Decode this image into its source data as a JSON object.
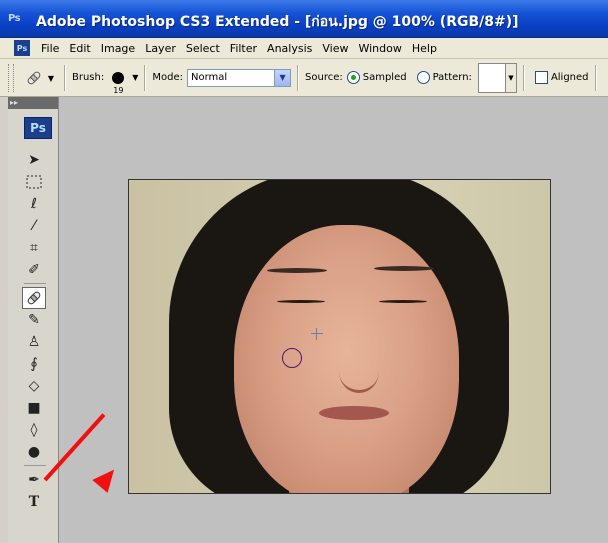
{
  "window": {
    "ps_badge": "Ps",
    "title": "Adobe Photoshop CS3 Extended - [ก่อน.jpg @ 100% (RGB/8#)]"
  },
  "menu": {
    "logo": "Ps",
    "items": [
      "File",
      "Edit",
      "Image",
      "Layer",
      "Select",
      "Filter",
      "Analysis",
      "View",
      "Window",
      "Help"
    ]
  },
  "options": {
    "tool_icon": "healing-brush-icon",
    "brush_label": "Brush:",
    "brush_size": "19",
    "mode_label": "Mode:",
    "mode_value": "Normal",
    "source_label": "Source:",
    "sampled_label": "Sampled",
    "pattern_label": "Pattern:",
    "aligned_label": "Aligned"
  },
  "toolbox": {
    "logo": "Ps",
    "tools": [
      {
        "name": "move-tool",
        "glyph": "▸✢"
      },
      {
        "name": "marquee-tool",
        "glyph": "⬚"
      },
      {
        "name": "lasso-tool",
        "glyph": "ℓ"
      },
      {
        "name": "magic-wand-tool",
        "glyph": "⁄"
      },
      {
        "name": "crop-tool",
        "glyph": "⌗"
      },
      {
        "name": "slice-tool",
        "glyph": "⁄"
      },
      {
        "name": "healing-brush-tool",
        "glyph": "✎",
        "active": true
      },
      {
        "name": "brush-tool",
        "glyph": "∕"
      },
      {
        "name": "clone-stamp-tool",
        "glyph": "♙"
      },
      {
        "name": "history-brush-tool",
        "glyph": "∮"
      },
      {
        "name": "eraser-tool",
        "glyph": "◊"
      },
      {
        "name": "gradient-tool",
        "glyph": "■"
      },
      {
        "name": "blur-tool",
        "glyph": "◮"
      },
      {
        "name": "dodge-tool",
        "glyph": "●"
      },
      {
        "name": "pen-tool",
        "glyph": "✒"
      },
      {
        "name": "type-tool",
        "glyph": "T"
      }
    ]
  },
  "colors": {
    "titlebar": "#0a3fc4",
    "chrome": "#ece9d8",
    "canvas": "#c0c0c0",
    "annotation_arrow": "#f01010"
  }
}
